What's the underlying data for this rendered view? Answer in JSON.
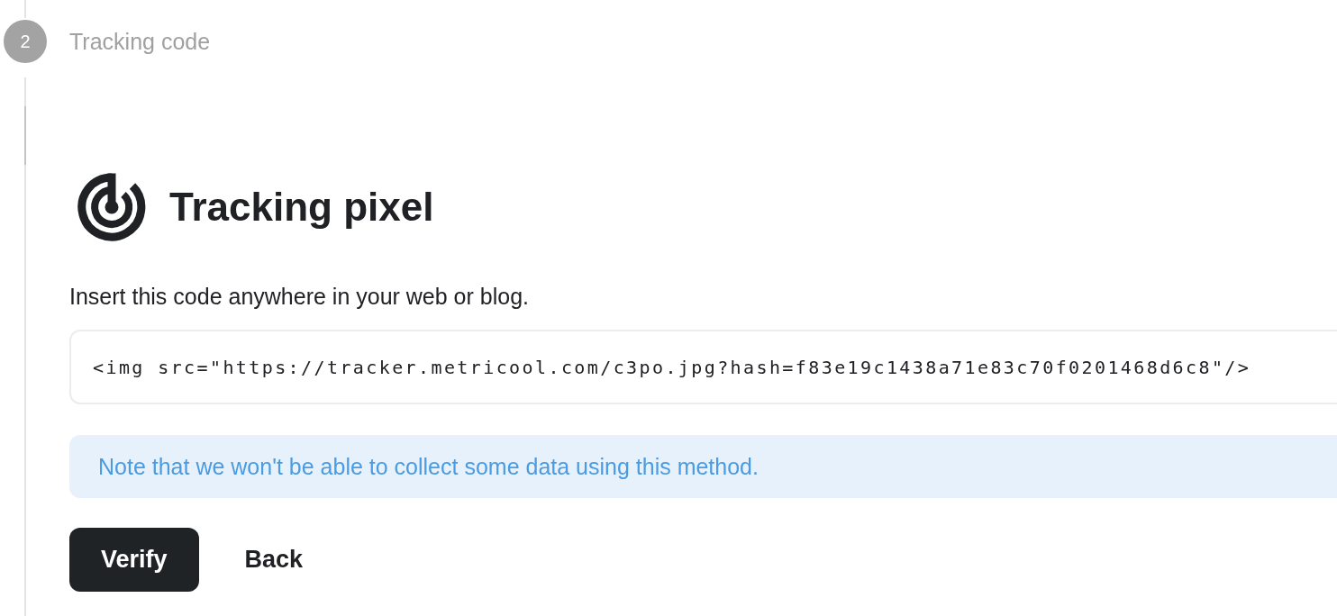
{
  "step": {
    "number": "2",
    "title": "Tracking code"
  },
  "heading": "Tracking pixel",
  "instruction": "Insert this code anywhere in your web or blog.",
  "code": "<img src=\"https://tracker.metricool.com/c3po.jpg?hash=f83e19c1438a71e83c70f0201468d6c8\"/>",
  "note": "Note that we won't be able to collect some data using this method.",
  "buttons": [
    {
      "label": "Verify",
      "kind": "primary"
    },
    {
      "label": "Back",
      "kind": "plain"
    }
  ]
}
